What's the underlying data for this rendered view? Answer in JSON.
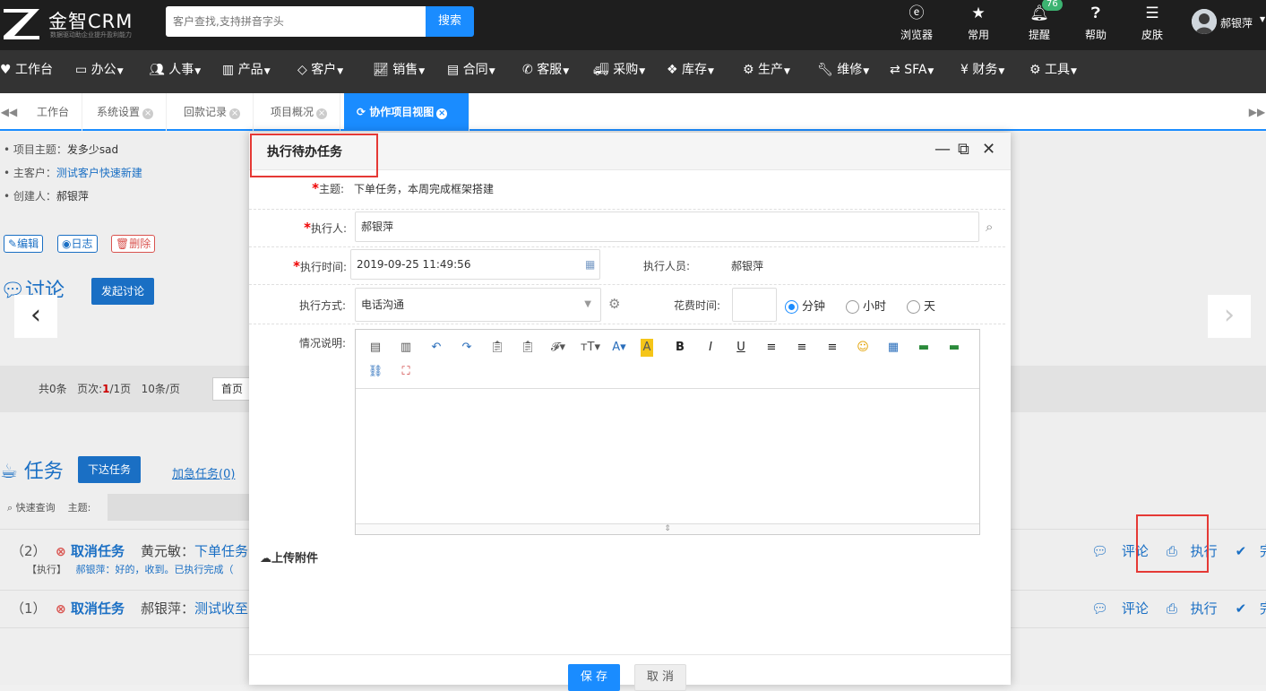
{
  "header": {
    "logo_text": "金智CRM",
    "logo_slogan": "数据驱动助企业提升盈利能力",
    "search_placeholder": "客户查找,支持拼音字头",
    "search_button": "搜索",
    "icons": [
      {
        "label": "浏览器",
        "icon": "ie-browser-icon"
      },
      {
        "label": "常用",
        "icon": "star-icon"
      },
      {
        "label": "提醒",
        "icon": "bell-icon",
        "badge": "76"
      },
      {
        "label": "帮助",
        "icon": "question-icon"
      },
      {
        "label": "皮肤",
        "icon": "skin-icon"
      }
    ],
    "user_name": "郝银萍"
  },
  "nav": [
    {
      "label": "工作台",
      "icon": "heart-icon"
    },
    {
      "label": "办公",
      "icon": "laptop-icon"
    },
    {
      "label": "人事",
      "icon": "users-icon"
    },
    {
      "label": "产品",
      "icon": "barcode-icon"
    },
    {
      "label": "客户",
      "icon": "diamond-icon"
    },
    {
      "label": "销售",
      "icon": "line-chart-icon"
    },
    {
      "label": "合同",
      "icon": "contract-icon"
    },
    {
      "label": "客服",
      "icon": "phone-icon"
    },
    {
      "label": "采购",
      "icon": "truck-icon"
    },
    {
      "label": "库存",
      "icon": "cubes-icon"
    },
    {
      "label": "生产",
      "icon": "cogs-icon"
    },
    {
      "label": "维修",
      "icon": "wrench-icon"
    },
    {
      "label": "SFA",
      "icon": "retweet-icon"
    },
    {
      "label": "财务",
      "icon": "yen-icon"
    },
    {
      "label": "工具",
      "icon": "gear-icon"
    }
  ],
  "tabs": [
    {
      "label": "工作台",
      "closable": false
    },
    {
      "label": "系统设置",
      "closable": true
    },
    {
      "label": "回款记录",
      "closable": true
    },
    {
      "label": "项目概况",
      "closable": true
    },
    {
      "label": "协作项目视图",
      "closable": true,
      "active": true
    }
  ],
  "background": {
    "project_subject_label": "项目主题：",
    "project_subject": "发多少sad",
    "main_customer_label": "主客户：",
    "main_customer": "测试客户快速新建",
    "creator_label": "创建人：",
    "creator": "郝银萍",
    "btn_edit": "编辑",
    "btn_log": "日志",
    "btn_delete": "删除",
    "discussion_title": "讨论",
    "start_discussion": "发起讨论",
    "pager_total": "共0条",
    "pager_pages_label": "页次:",
    "pager_current": "1",
    "pager_total_pages": "/1页",
    "pager_per_page": "10条/页",
    "first_page": "首页",
    "task_title": "任务",
    "assign_task": "下达任务",
    "urgent_task": "加急任务(0)",
    "quick_search": "快速查询",
    "subject_label": "主题:",
    "tasks": [
      {
        "num": "（2）",
        "cancel": "取消任务",
        "who": "黄元敏：",
        "subject": "下单任务",
        "sub_tag": "【执行】",
        "sub_text": "郝银萍：好的，收到。已执行完成（"
      },
      {
        "num": "（1）",
        "cancel": "取消任务",
        "who": "郝银萍：",
        "subject": "测试收至"
      }
    ],
    "op_comment": "评论",
    "op_execute": "执行",
    "op_done": "完成"
  },
  "modal": {
    "title": "执行待办任务",
    "subject_label": "主题:",
    "subject_value": "下单任务，本周完成框架搭建",
    "executor_label": "执行人:",
    "executor_value": "郝银萍",
    "exec_time_label": "执行时间:",
    "exec_time_value": "2019-09-25 11:49:56",
    "exec_person_label": "执行人员:",
    "exec_person_value": "郝银萍",
    "exec_method_label": "执行方式:",
    "exec_method_value": "电话沟通",
    "time_spent_label": "花费时间:",
    "unit_minute": "分钟",
    "unit_hour": "小时",
    "unit_day": "天",
    "description_label": "情况说明:",
    "upload_label": "上传附件",
    "save": "保 存",
    "cancel": "取 消"
  },
  "colors": {
    "accent": "#1a8cff",
    "highlight_frame": "#e53935",
    "header_bg": "#1e1e1e",
    "nav_bg": "#333333"
  }
}
